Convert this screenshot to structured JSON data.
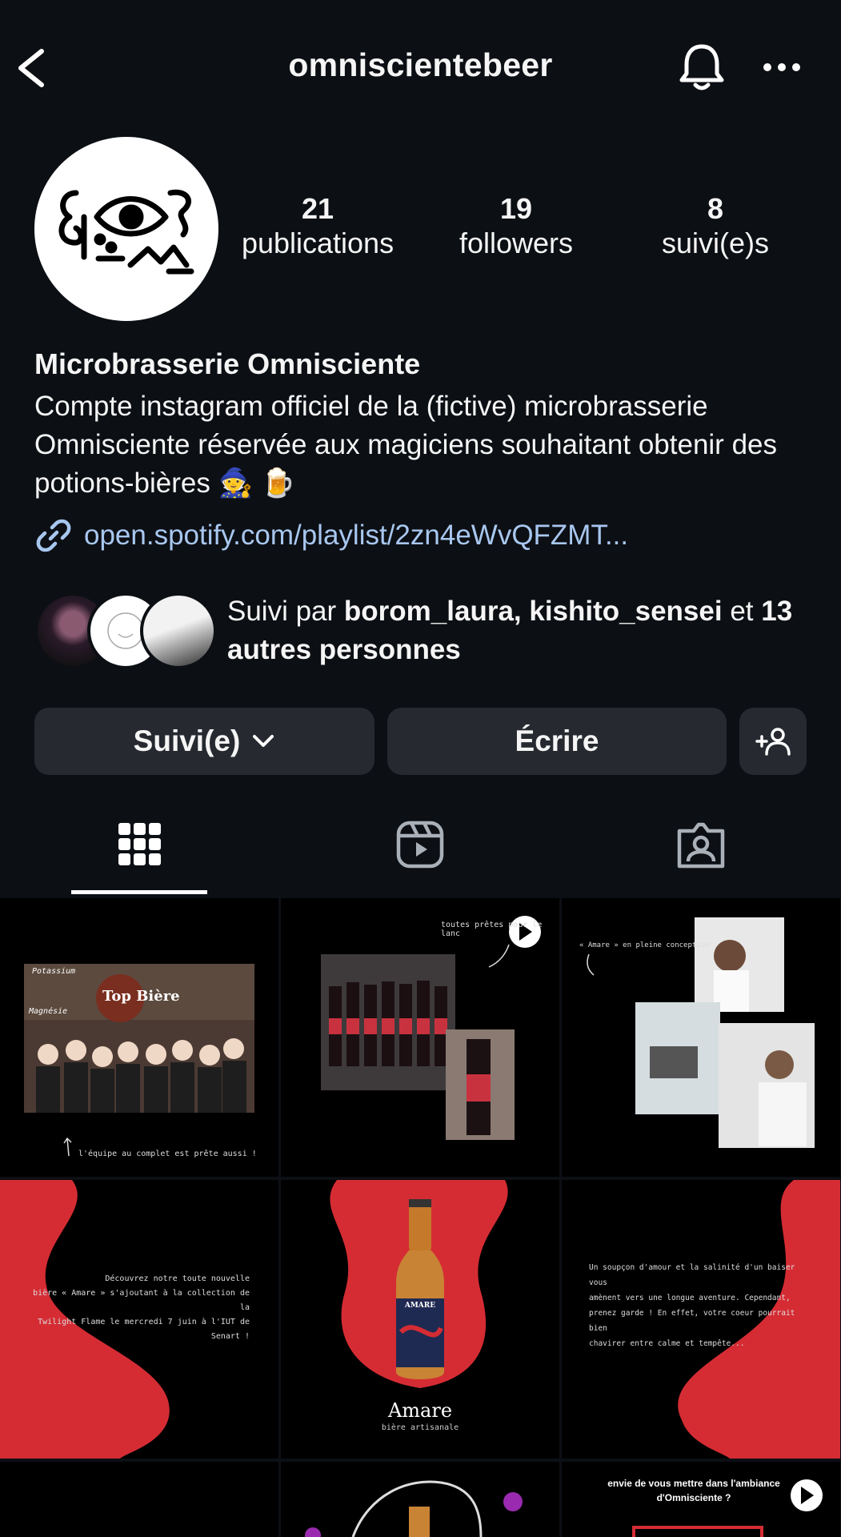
{
  "header": {
    "title": "omniscientebeer",
    "icons": [
      "back-arrow-icon",
      "bell-icon",
      "more-icon"
    ]
  },
  "profile": {
    "stats": [
      {
        "num": "21",
        "label": "publications"
      },
      {
        "num": "19",
        "label": "followers"
      },
      {
        "num": "8",
        "label": "suivi(e)s"
      }
    ],
    "name": "Microbrasserie Omnisciente",
    "bio": "Compte instagram officiel de la (fictive) microbrasserie Omnisciente réservée aux magiciens souhaitant obtenir des potions-bières 🧙 🍺",
    "link": "open.spotify.com/playlist/2zn4eWvQFZMT..."
  },
  "followed_by": {
    "prefix": "Suivi par ",
    "user1": "borom_laura",
    "sep": ", ",
    "user2": "kishito_sensei",
    "suffix": " et ",
    "others": "13 autres personnes"
  },
  "actions": {
    "following": "Suivi(e)",
    "message": "Écrire"
  },
  "tabs": [
    "grid-icon",
    "reels-icon",
    "tagged-icon"
  ],
  "posts": {
    "p1": {
      "tag1": "Potassium",
      "tag2": "Magnésie",
      "tag3": "Top Bière",
      "caption": "l'équipe au complet est prête aussi !"
    },
    "p2": {
      "caption": "toutes prêtes pour le lanc"
    },
    "p3": {
      "caption": "« Amare » en pleine conception"
    },
    "p4": {
      "line1": "Découvrez notre toute nouvelle",
      "line2": "bière « Amare » s'ajoutant à la collection de la",
      "line3": "Twilight Flame le mercredi 7 juin à l'IUT de Senart !"
    },
    "p5": {
      "brand": "Amare",
      "sub": "bière artisanale",
      "label": "AMARE"
    },
    "p6": {
      "line1": "Un soupçon d'amour et la salinité d'un baiser vous",
      "line2": "amènent vers une longue aventure. Cependant,",
      "line3": "prenez garde ! En effet, votre coeur pourrait bien",
      "line4": "chavirer entre calme et tempête..."
    },
    "p9": {
      "line1": "envie de vous mettre dans l'ambiance",
      "line2": "d'Omnisciente ?"
    }
  }
}
